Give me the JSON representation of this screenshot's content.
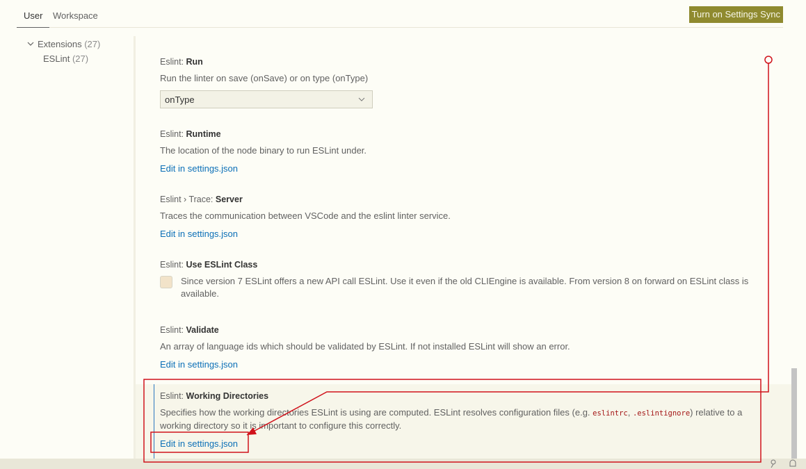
{
  "scope_tabs": {
    "user": "User",
    "workspace": "Workspace"
  },
  "sync_button": "Turn on Settings Sync",
  "toc": {
    "extensions": {
      "label": "Extensions",
      "count": "(27)"
    },
    "eslint": {
      "label": "ESLint",
      "count": "(27)"
    }
  },
  "settings": {
    "run": {
      "prefix": "Eslint: ",
      "name": "Run",
      "description": "Run the linter on save (onSave) or on type (onType)",
      "value": "onType"
    },
    "runtime": {
      "prefix": "Eslint: ",
      "name": "Runtime",
      "description": "The location of the node binary to run ESLint under.",
      "link": "Edit in settings.json"
    },
    "trace": {
      "prefix": "Eslint › Trace: ",
      "name": "Server",
      "description": "Traces the communication between VSCode and the eslint linter service.",
      "link": "Edit in settings.json"
    },
    "use_class": {
      "prefix": "Eslint: ",
      "name": "Use ESLint Class",
      "description": "Since version 7 ESLint offers a new API call ESLint. Use it even if the old CLIEngine is available. From version 8 on forward on ESLint class is available."
    },
    "validate": {
      "prefix": "Eslint: ",
      "name": "Validate",
      "description": "An array of language ids which should be validated by ESLint. If not installed ESLint will show an error.",
      "link": "Edit in settings.json"
    },
    "working_dirs": {
      "prefix": "Eslint: ",
      "name": "Working Directories",
      "desc_part1": "Specifies how the working directories ESLint is using are computed. ESLint resolves configuration files (e.g. ",
      "code1": "eslintrc",
      "sep": ", ",
      "code2": ".eslintignore",
      "desc_part2": ") relative to a working directory so it is important to configure this correctly.",
      "link": "Edit in settings.json"
    }
  },
  "colors": {
    "accent_link": "#0b6fb7",
    "sync_bg": "#8f8a2f",
    "annotation": "#d0121b"
  },
  "icons": {
    "chevron": "chevron-down-icon",
    "select": "chevron-down-icon",
    "status_left": "broadcast-icon",
    "status_right": "bell-icon"
  }
}
